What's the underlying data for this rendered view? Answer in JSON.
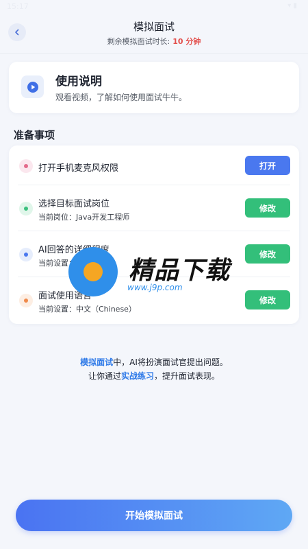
{
  "status_bar": {
    "time": "15:17",
    "icons": "▾ ▮"
  },
  "header": {
    "title": "模拟面试",
    "subtitle_label": "剩余模拟面试时长:",
    "subtitle_value": "10 分钟"
  },
  "intro": {
    "title": "使用说明",
    "desc": "观看视频，了解如何使用面试牛牛。"
  },
  "prep": {
    "section_title": "准备事项",
    "items": [
      {
        "title": "打开手机麦克风权限",
        "sub": "",
        "button": "打开",
        "button_color": "#4a78ef",
        "dot_color": "#e46a8b",
        "dot_bg": "#fbe7ee"
      },
      {
        "title": "选择目标面试岗位",
        "sub": "当前岗位：Java开发工程师",
        "button": "修改",
        "button_color": "#33bf7a",
        "dot_color": "#3ac07d",
        "dot_bg": "#e0f6ea"
      },
      {
        "title": "AI回答的详细程度",
        "sub": "当前设置：适中",
        "button": "修改",
        "button_color": "#33bf7a",
        "dot_color": "#4a78ef",
        "dot_bg": "#e6edfc"
      },
      {
        "title": "面试使用语言",
        "sub": "当前设置：中文（Chinese）",
        "button": "修改",
        "button_color": "#33bf7a",
        "dot_color": "#f08a4b",
        "dot_bg": "#fdeee3"
      }
    ]
  },
  "watermark": {
    "text": "精品下载",
    "url": "www.j9p.com"
  },
  "footnote": {
    "hl1": "模拟面试",
    "t1": "中，AI将扮演面试官提出问题。",
    "t2": "让你通过",
    "hl2": "实战练习",
    "t3": "，提升面试表现。"
  },
  "start_button": "开始模拟面试",
  "icons": {
    "back": "chevron-left-icon",
    "play": "play-circle-icon"
  }
}
